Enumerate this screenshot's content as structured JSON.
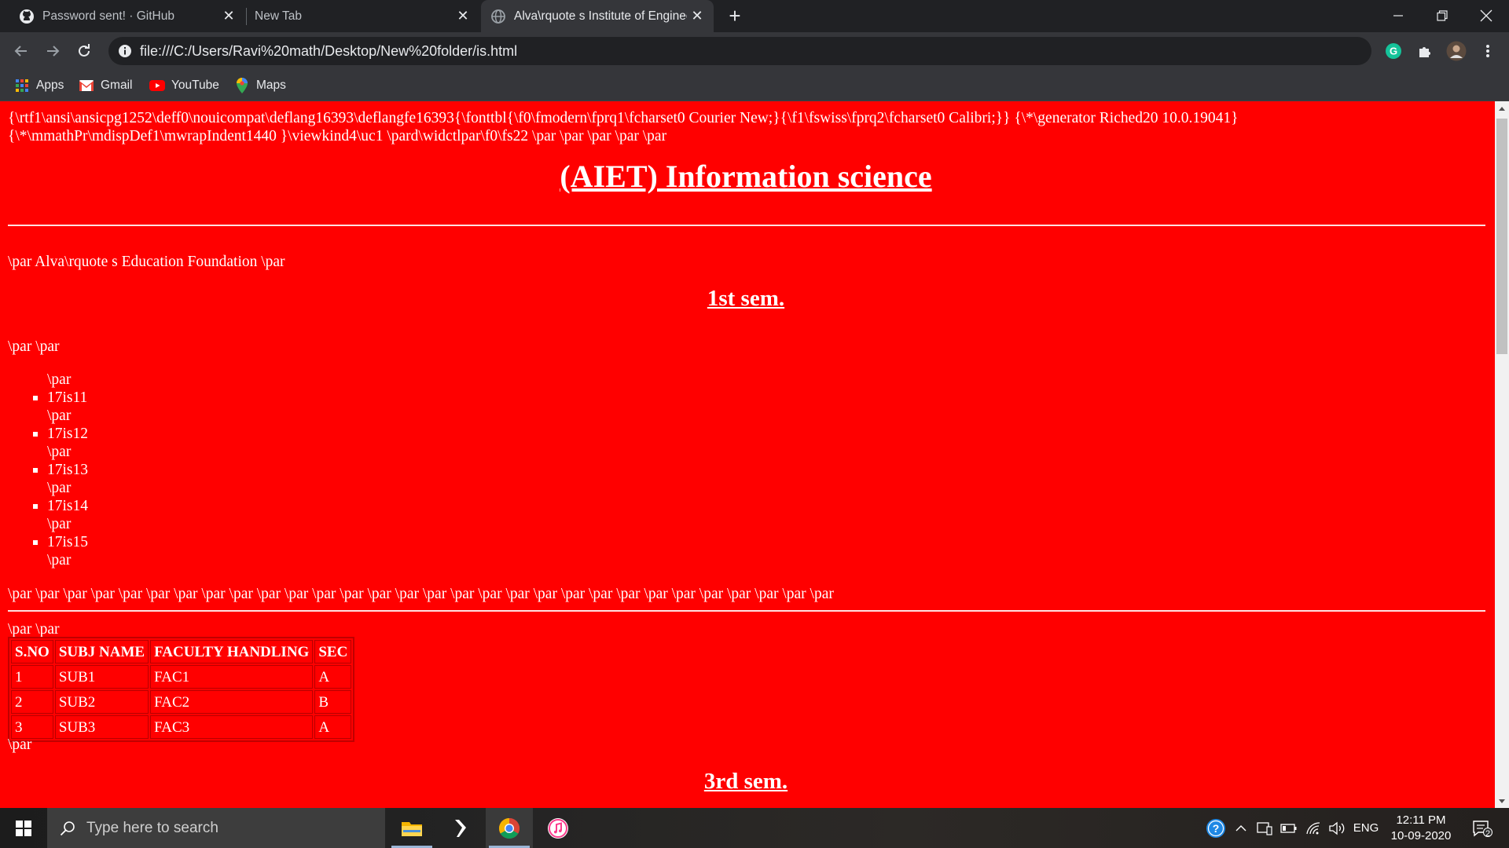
{
  "browser": {
    "tabs": [
      {
        "title": "Password sent! · GitHub",
        "icon": "github-icon",
        "active": false
      },
      {
        "title": "New Tab",
        "icon": "",
        "active": false
      },
      {
        "title": "Alva\\rquote s Institute of Enginee",
        "icon": "globe-icon",
        "active": true
      }
    ],
    "address": "file:///C:/Users/Ravi%20math/Desktop/New%20folder/is.html",
    "bookmarks": [
      {
        "label": "Apps",
        "icon": "apps-grid-icon"
      },
      {
        "label": "Gmail",
        "icon": "gmail-icon"
      },
      {
        "label": "YouTube",
        "icon": "youtube-icon"
      },
      {
        "label": "Maps",
        "icon": "maps-icon"
      }
    ],
    "extensions": [
      "grammarly-icon",
      "extensions-puzzle-icon",
      "profile-avatar",
      "kebab-menu-icon"
    ]
  },
  "page": {
    "rtf_header": [
      "{\\rtf1\\ansi\\ansicpg1252\\deff0\\nouicompat\\deflang16393\\deflangfe16393{\\fonttbl{\\f0\\fmodern\\fprq1\\fcharset0 Courier New;}{\\f1\\fswiss\\fprq2\\fcharset0 Calibri;}} {\\*\\generator Riched20 10.0.19041}",
      "{\\*\\mmathPr\\mdispDef1\\mwrapIndent1440 }\\viewkind4\\uc1 \\pard\\widctlpar\\f0\\fs22 \\par \\par \\par \\par \\par"
    ],
    "title": "(AIET) Information science",
    "foundation_line": "\\par Alva\\rquote s Education Foundation \\par",
    "sem1_heading": "1st sem.",
    "par_par": "\\par \\par",
    "par": "\\par",
    "sem1_subjects": [
      "17is11",
      "17is12",
      "17is13",
      "17is14",
      "17is15"
    ],
    "par_run": "\\par \\par \\par \\par \\par \\par \\par \\par \\par \\par \\par \\par \\par \\par \\par \\par \\par \\par \\par \\par \\par \\par \\par \\par \\par \\par \\par \\par \\par \\par",
    "table": {
      "headers": [
        "S.NO",
        "SUBJ NAME",
        "FACULTY HANDLING",
        "SEC"
      ],
      "rows": [
        [
          "1",
          "SUB1",
          "FAC1",
          "A"
        ],
        [
          "2",
          "SUB2",
          "FAC2",
          "B"
        ],
        [
          "3",
          "SUB3",
          "FAC3",
          "A"
        ]
      ]
    },
    "sem3_heading": "3rd sem."
  },
  "taskbar": {
    "search_placeholder": "Type here to search",
    "apps": [
      "file-explorer-icon",
      "visual-studio-icon",
      "chrome-icon",
      "itunes-icon"
    ],
    "tray": {
      "language": "ENG",
      "time": "12:11 PM",
      "date": "10-09-2020",
      "notification_count": "2"
    }
  },
  "colors": {
    "page_background": "#ff0000",
    "page_text": "#ffffff",
    "chrome_dark": "#202124",
    "chrome_toolbar": "#35363a"
  }
}
